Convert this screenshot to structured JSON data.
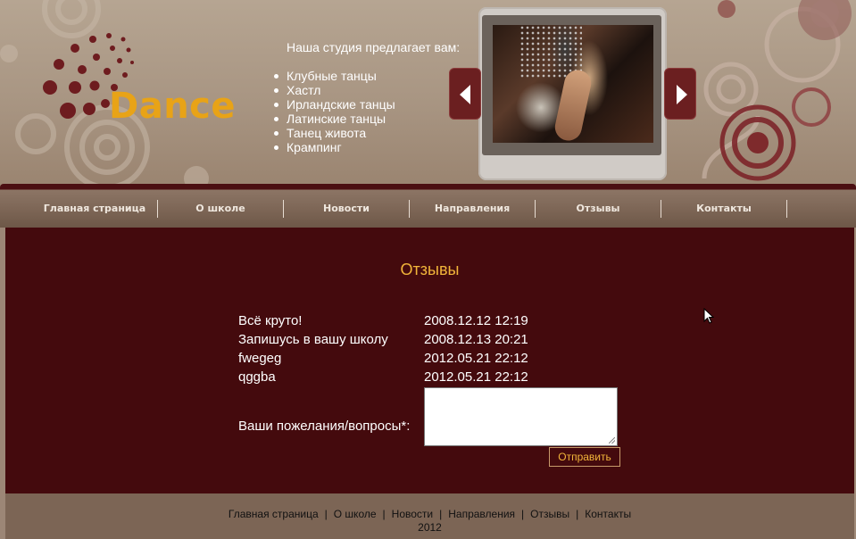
{
  "logo": {
    "text": "Dance"
  },
  "offer": {
    "title": "Наша студия предлагает вам:",
    "items": [
      "Клубные танцы",
      "Хастл",
      "Ирландские танцы",
      "Латинские танцы",
      "Танец живота",
      "Крампинг"
    ]
  },
  "nav": {
    "items": [
      "Главная страница",
      "О школе",
      "Новости",
      "Направления",
      "Отзывы",
      "Контакты"
    ]
  },
  "main": {
    "title": "Отзывы",
    "reviews": [
      {
        "text": "Всё круто!",
        "date": "2008.12.12 12:19"
      },
      {
        "text": "Запишусь в вашу школу",
        "date": "2008.12.13 20:21"
      },
      {
        "text": "fwegeg",
        "date": "2012.05.21 22:12"
      },
      {
        "text": "qggba",
        "date": "2012.05.21 22:12"
      }
    ],
    "form": {
      "label": "Ваши пожелания/вопросы*:",
      "textarea_value": "",
      "submit_label": "Отправить"
    }
  },
  "footer": {
    "links": [
      "Главная страница",
      "О школе",
      "Новости",
      "Направления",
      "Отзывы",
      "Контакты"
    ],
    "separator": "|",
    "year": "2012"
  },
  "colors": {
    "accent": "#f2b53a",
    "logo": "#e8a317",
    "content_bg": "#440a0d",
    "header_bg": "#a89582",
    "footer_bg": "#7c6555"
  }
}
